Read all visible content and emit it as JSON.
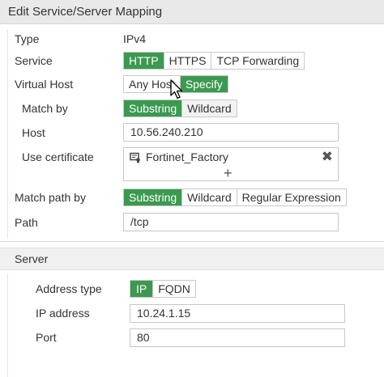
{
  "dialog": {
    "title": "Edit Service/Server Mapping"
  },
  "form": {
    "type": {
      "label": "Type",
      "value": "IPv4"
    },
    "service": {
      "label": "Service",
      "options": [
        "HTTP",
        "HTTPS",
        "TCP Forwarding"
      ],
      "selected": "HTTP"
    },
    "virtual_host": {
      "label": "Virtual Host",
      "options": [
        "Any Host",
        "Specify"
      ],
      "selected": "Specify"
    },
    "match_by": {
      "label": "Match by",
      "options": [
        "Substring",
        "Wildcard"
      ],
      "selected": "Substring"
    },
    "host": {
      "label": "Host",
      "value": "10.56.240.210"
    },
    "use_certificate": {
      "label": "Use certificate",
      "value": "Fortinet_Factory",
      "remove_symbol": "✖",
      "add_symbol": "+"
    },
    "match_path_by": {
      "label": "Match path by",
      "options": [
        "Substring",
        "Wildcard",
        "Regular Expression"
      ],
      "selected": "Substring"
    },
    "path": {
      "label": "Path",
      "value": "/tcp"
    }
  },
  "server": {
    "section_title": "Server",
    "address_type": {
      "label": "Address type",
      "options": [
        "IP",
        "FQDN"
      ],
      "selected": "IP"
    },
    "ip_address": {
      "label": "IP address",
      "value": "10.24.1.15"
    },
    "port": {
      "label": "Port",
      "value": "80"
    }
  },
  "colors": {
    "accent": "#3b9950",
    "title_bg": "#e9e9e9",
    "section_bg": "#f0f0f0"
  },
  "icons": {
    "certificate": "certificate-icon",
    "cursor": "mouse-pointer-icon"
  }
}
